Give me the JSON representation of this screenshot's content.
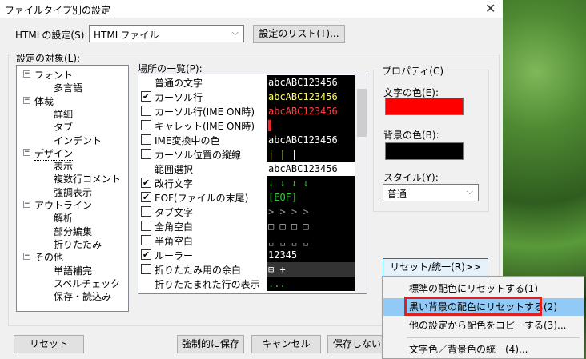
{
  "window": {
    "title": "ファイルタイプ別の設定",
    "close": "✕"
  },
  "filetype": {
    "label": "HTMLの設定(S):",
    "value": "HTMLファイル",
    "list_button": "設定のリスト(T)..."
  },
  "targets": {
    "label": "設定の対象(L):",
    "nodes": [
      {
        "text": "フォント",
        "level": 0,
        "expander": "−"
      },
      {
        "text": "多言語",
        "level": 1
      },
      {
        "text": "体裁",
        "level": 0,
        "expander": "−"
      },
      {
        "text": "詳細",
        "level": 1
      },
      {
        "text": "タブ",
        "level": 1
      },
      {
        "text": "インデント",
        "level": 1
      },
      {
        "text": "デザイン",
        "level": 0,
        "expander": "−",
        "selected": true
      },
      {
        "text": "表示",
        "level": 1
      },
      {
        "text": "複数行コメント",
        "level": 1
      },
      {
        "text": "強調表示",
        "level": 1
      },
      {
        "text": "アウトライン",
        "level": 0,
        "expander": "−"
      },
      {
        "text": "解析",
        "level": 1
      },
      {
        "text": "部分編集",
        "level": 1
      },
      {
        "text": "折りたたみ",
        "level": 1
      },
      {
        "text": "その他",
        "level": 0,
        "expander": "−"
      },
      {
        "text": "単語補完",
        "level": 1
      },
      {
        "text": "スペルチェック",
        "level": 1
      },
      {
        "text": "保存・読込み",
        "level": 1
      }
    ]
  },
  "places": {
    "label": "場所の一覧(P):",
    "rows": [
      {
        "name": "普通の文字",
        "check": null,
        "preview": "abcABC123456",
        "fg": "#ffffff",
        "bg": "#000000"
      },
      {
        "name": "カーソル行",
        "check": true,
        "preview": "abcABC123456",
        "fg": "#ffff66",
        "bg": "#000000"
      },
      {
        "name": "カーソル行(IME ON時)",
        "check": false,
        "preview": "abcABC123456",
        "fg": "#ff4040",
        "bg": "#000000"
      },
      {
        "name": "キャレット(IME ON時)",
        "check": false,
        "preview": "▌",
        "fg": "#ff2020",
        "bg": "#000000"
      },
      {
        "name": "IME変換中の色",
        "check": false,
        "preview": "abcABC123456",
        "fg": "#ffffff",
        "bg": "#000000"
      },
      {
        "name": "カーソル位置の縦線",
        "check": false,
        "preview": "|  |  |",
        "fg": "#ffff66",
        "bg": "#000000"
      },
      {
        "name": "範囲選択",
        "check": null,
        "preview": "abcABC123456",
        "fg": "#000000",
        "bg": "#ffffff"
      },
      {
        "name": "改行文字",
        "check": true,
        "preview": "↓  ↓  ↓  ↓",
        "fg": "#33cc33",
        "bg": "#000000"
      },
      {
        "name": "EOF(ファイルの末尾)",
        "check": true,
        "preview": "[EOF]",
        "fg": "#33cc33",
        "bg": "#000000"
      },
      {
        "name": "タブ文字",
        "check": false,
        "preview": ">   >   >   >",
        "fg": "#999999",
        "bg": "#000000"
      },
      {
        "name": "全角空白",
        "check": false,
        "preview": "□  □  □  □",
        "fg": "#bbbbbb",
        "bg": "#000000"
      },
      {
        "name": "半角空白",
        "check": false,
        "preview": "␣  ␣  ␣  ␣",
        "fg": "#888888",
        "bg": "#000000"
      },
      {
        "name": "ルーラー",
        "check": true,
        "preview": "12345",
        "fg": "#ffffff",
        "bg": "#000000"
      },
      {
        "name": "折りたたみ用の余白",
        "check": false,
        "preview": "⊞ +",
        "fg": "#ffffff",
        "bg": "#333333"
      },
      {
        "name": "折りたたまれた行の表示",
        "check": null,
        "preview": "...",
        "fg": "#33cc33",
        "bg": "#000000"
      }
    ]
  },
  "property": {
    "group": "プロパティ(C)",
    "text_color_label": "文字の色(E):",
    "text_color": "#ff0000",
    "bg_color_label": "背景の色(B):",
    "bg_color": "#000000",
    "style_label": "スタイル(Y):",
    "style_value": "普通",
    "reset_unify_button": "リセット/統一(R)>>"
  },
  "menu": {
    "items": [
      "標準の配色にリセットする(1)",
      "黒い背景の配色にリセットする(2)",
      "他の設定から配色をコピーする(3)...",
      "文字色／背景色の統一(4)..."
    ]
  },
  "footer": {
    "reset": "リセット",
    "force_save": "強制的に保存",
    "cancel": "キャンセル",
    "no_save": "保存しないで"
  }
}
